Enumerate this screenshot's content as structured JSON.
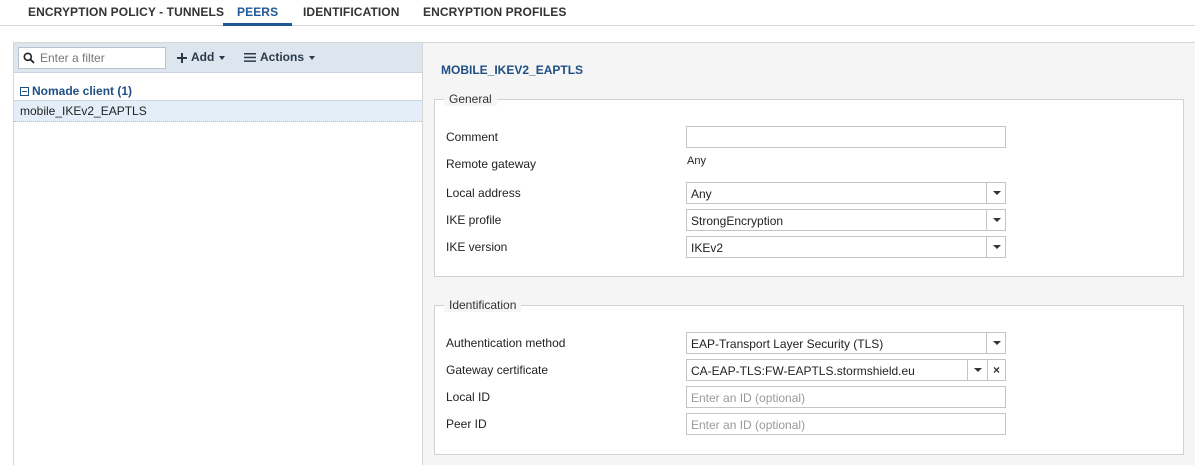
{
  "tabs": [
    {
      "label": "ENCRYPTION POLICY - TUNNELS",
      "active": false
    },
    {
      "label": "PEERS",
      "active": true
    },
    {
      "label": "IDENTIFICATION",
      "active": false
    },
    {
      "label": "ENCRYPTION PROFILES",
      "active": false
    }
  ],
  "toolbar": {
    "filter_placeholder": "Enter a filter",
    "add_label": "Add",
    "actions_label": "Actions"
  },
  "tree": {
    "group_label": "Nomade client (1)",
    "items": [
      {
        "label": "mobile_IKEv2_EAPTLS",
        "selected": true
      }
    ]
  },
  "detail": {
    "title": "MOBILE_IKEV2_EAPTLS",
    "general": {
      "legend": "General",
      "comment_label": "Comment",
      "comment_value": "",
      "remote_gateway_label": "Remote gateway",
      "remote_gateway_value": "Any",
      "local_address_label": "Local address",
      "local_address_value": "Any",
      "ike_profile_label": "IKE profile",
      "ike_profile_value": "StrongEncryption",
      "ike_version_label": "IKE version",
      "ike_version_value": "IKEv2"
    },
    "identification": {
      "legend": "Identification",
      "auth_method_label": "Authentication method",
      "auth_method_value": "EAP-Transport Layer Security (TLS)",
      "gateway_cert_label": "Gateway certificate",
      "gateway_cert_value": "CA-EAP-TLS:FW-EAPTLS.stormshield.eu",
      "local_id_label": "Local ID",
      "local_id_placeholder": "Enter an ID (optional)",
      "peer_id_label": "Peer ID",
      "peer_id_placeholder": "Enter an ID (optional)"
    }
  },
  "colors": {
    "accent": "#1f5a96",
    "toolbar_bg": "#dde6ef",
    "selected_row": "#e4eef8"
  }
}
